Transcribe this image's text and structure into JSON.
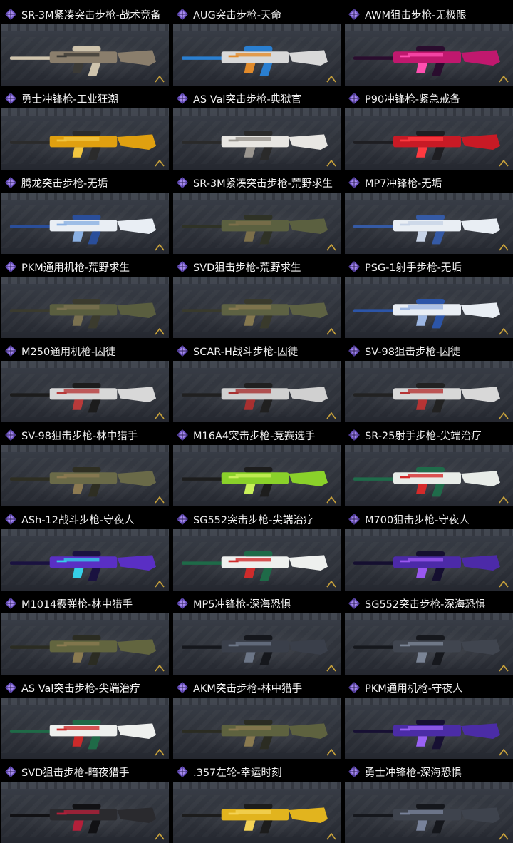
{
  "items": [
    {
      "label": "SR-3M紧凑突击步枪-战术竞备",
      "skin": [
        "#8a7e6c",
        "#cfc4ad",
        "#3b3a36"
      ]
    },
    {
      "label": "AUG突击步枪-天命",
      "skin": [
        "#d9d9d9",
        "#2a7fd1",
        "#e28b2b"
      ]
    },
    {
      "label": "AWM狙击步枪-无极限",
      "skin": [
        "#c0186e",
        "#2a0d2e",
        "#ff4fb0"
      ]
    },
    {
      "label": "勇士冲锋枪-工业狂潮",
      "skin": [
        "#e0a010",
        "#2b2b2b",
        "#f2c640"
      ]
    },
    {
      "label": "AS Val突击步枪-典狱官",
      "skin": [
        "#e8e6e2",
        "#2a2a2a",
        "#9a9690"
      ]
    },
    {
      "label": "P90冲锋枪-紧急戒备",
      "skin": [
        "#c81a25",
        "#1e1e22",
        "#ff3a40"
      ]
    },
    {
      "label": "腾龙突击步枪-无垢",
      "skin": [
        "#e9eef4",
        "#2a4e9a",
        "#8ab0e2"
      ]
    },
    {
      "label": "SR-3M紧凑突击步枪-荒野求生",
      "skin": [
        "#5b6040",
        "#2f3226",
        "#7c6f4a"
      ]
    },
    {
      "label": "MP7冲锋枪-无垢",
      "skin": [
        "#e9eef4",
        "#355aa5",
        "#c7d3e6"
      ]
    },
    {
      "label": "PKM通用机枪-荒野求生",
      "skin": [
        "#5a5e3f",
        "#3b3b2e",
        "#7a7150"
      ]
    },
    {
      "label": "SVD狙击步枪-荒野求生",
      "skin": [
        "#5e6243",
        "#393a2c",
        "#85784f"
      ]
    },
    {
      "label": "PSG-1射手步枪-无垢",
      "skin": [
        "#e9eef4",
        "#2c55a8",
        "#9db7e3"
      ]
    },
    {
      "label": "M250通用机枪-囚徒",
      "skin": [
        "#d8d8d8",
        "#1c1c1c",
        "#b83a3a"
      ]
    },
    {
      "label": "SCAR-H战斗步枪-囚徒",
      "skin": [
        "#d0d0d0",
        "#202020",
        "#a83030"
      ]
    },
    {
      "label": "SV-98狙击步枪-囚徒",
      "skin": [
        "#d8d8d8",
        "#222222",
        "#b63434"
      ]
    },
    {
      "label": "SV-98狙击步枪-林中猎手",
      "skin": [
        "#6a6a48",
        "#2e2e22",
        "#8c7a52"
      ]
    },
    {
      "label": "M16A4突击步枪-竞赛选手",
      "skin": [
        "#8ad12a",
        "#1d1d1d",
        "#c9f05a"
      ]
    },
    {
      "label": "SR-25射手步枪-尖端治疗",
      "skin": [
        "#e8ece8",
        "#1f6b4a",
        "#d42a2a"
      ]
    },
    {
      "label": "ASh-12战斗步枪-守夜人",
      "skin": [
        "#5a2fc4",
        "#1a1240",
        "#35d0e8"
      ]
    },
    {
      "label": "SG552突击步枪-尖端治疗",
      "skin": [
        "#eef0ee",
        "#1e6a48",
        "#cf2b2b"
      ]
    },
    {
      "label": "M700狙击步枪-守夜人",
      "skin": [
        "#4c2aa8",
        "#150f30",
        "#9a58f0"
      ]
    },
    {
      "label": "M1014霰弹枪-林中猎手",
      "skin": [
        "#62653f",
        "#2b2c22",
        "#8a7a50"
      ]
    },
    {
      "label": "MP5冲锋枪-深海恐惧",
      "skin": [
        "#3a3f4a",
        "#15171c",
        "#6c7687"
      ]
    },
    {
      "label": "SG552突击步枪-深海恐惧",
      "skin": [
        "#40454f",
        "#16181d",
        "#7a8495"
      ]
    },
    {
      "label": "AS Val突击步枪-尖端治疗",
      "skin": [
        "#eef0ee",
        "#1f6a47",
        "#cc2a2a"
      ]
    },
    {
      "label": "AKM突击步枪-林中猎手",
      "skin": [
        "#5e623f",
        "#2b2c22",
        "#8a7a50"
      ]
    },
    {
      "label": "PKM通用机枪-守夜人",
      "skin": [
        "#4b2ca6",
        "#171033",
        "#9a62f5"
      ]
    },
    {
      "label": "SVD狙击步枪-暗夜猎手",
      "skin": [
        "#2a2a2e",
        "#111114",
        "#b3203a"
      ]
    },
    {
      "label": ".357左轮-幸运时刻",
      "skin": [
        "#e2b41e",
        "#1c1c1c",
        "#f4d356"
      ]
    },
    {
      "label": "勇士冲锋枪-深海恐惧",
      "skin": [
        "#3e434d",
        "#15171c",
        "#78829a"
      ]
    }
  ],
  "colors": {
    "rarity": "#a68bea",
    "rarity_dark": "#6f55c8"
  }
}
